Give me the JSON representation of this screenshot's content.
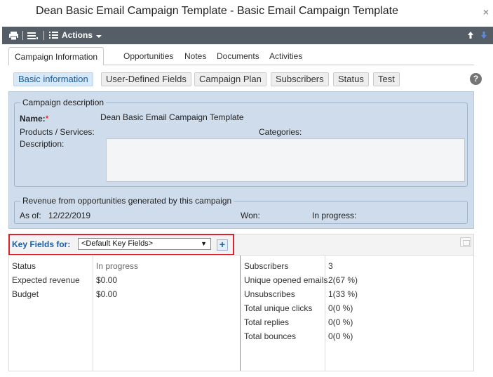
{
  "window": {
    "title": "Dean Basic Email Campaign Template - Basic Email Campaign Template",
    "close_glyph": "×"
  },
  "toolbar": {
    "actions_label": "Actions"
  },
  "tabs": [
    {
      "label": "Campaign Information",
      "active": true
    },
    {
      "label": "Opportunities"
    },
    {
      "label": "Notes"
    },
    {
      "label": "Documents"
    },
    {
      "label": "Activities"
    }
  ],
  "subtabs": [
    {
      "label": "Basic information",
      "active": true
    },
    {
      "label": "User-Defined Fields"
    },
    {
      "label": "Campaign Plan"
    },
    {
      "label": "Subscribers"
    },
    {
      "label": "Status"
    },
    {
      "label": "Test"
    }
  ],
  "help_glyph": "?",
  "campaign_description": {
    "legend": "Campaign description",
    "name_label": "Name:",
    "required_mark": "*",
    "name_value": "Dean Basic Email Campaign Template",
    "products_label": "Products / Services:",
    "categories_label": "Categories:",
    "description_label": "Description:"
  },
  "revenue": {
    "legend": "Revenue from opportunities generated by this campaign",
    "as_of_label": "As of:",
    "as_of_value": "12/22/2019",
    "won_label": "Won:",
    "in_progress_label": "In progress:"
  },
  "key_fields": {
    "label": "Key Fields for:",
    "selected": "<Default Key Fields>",
    "caret": "▼",
    "add_glyph": "+"
  },
  "left_fields": [
    {
      "label": "Status",
      "value": "In progress"
    },
    {
      "label": "Expected revenue",
      "value": "$0.00"
    },
    {
      "label": "Budget",
      "value": "$0.00"
    }
  ],
  "right_fields": [
    {
      "label": "Subscribers",
      "value": "3"
    },
    {
      "label": "Unique opened emails",
      "value": "2(67 %)"
    },
    {
      "label": "Unsubscribes",
      "value": "1(33 %)"
    },
    {
      "label": "Total unique clicks",
      "value": "0(0 %)"
    },
    {
      "label": "Total replies",
      "value": "0(0 %)"
    },
    {
      "label": "Total bounces",
      "value": "0(0 %)"
    }
  ],
  "colors": {
    "toolbar_bg": "#555d66",
    "panel_bg": "#cedceb",
    "accent": "#1d5fa6",
    "highlight": "#d9232d"
  },
  "icons": [
    "print-icon",
    "list-icon",
    "list-detail-icon",
    "dropdown-caret-icon",
    "arrow-up-icon",
    "arrow-down-icon",
    "help-icon",
    "collapse-panel-icon"
  ]
}
